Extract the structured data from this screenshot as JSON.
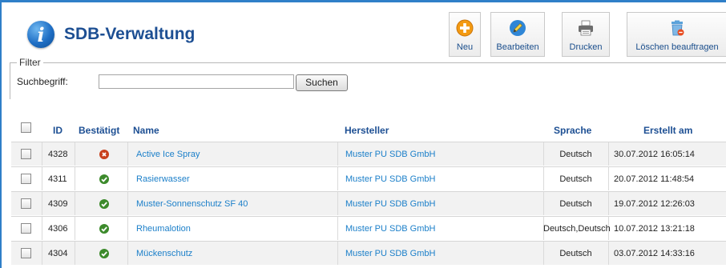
{
  "header": {
    "title": "SDB-Verwaltung",
    "logo_letter": "i"
  },
  "toolbar": {
    "new_label": "Neu",
    "edit_label": "Bearbeiten",
    "print_label": "Drucken",
    "delete_label": "Löschen beauftragen"
  },
  "filter": {
    "legend": "Filter",
    "search_label": "Suchbegriff:",
    "search_value": "",
    "search_button": "Suchen"
  },
  "table": {
    "columns": {
      "id": "ID",
      "confirmed": "Bestätigt",
      "name": "Name",
      "manufacturer": "Hersteller",
      "language": "Sprache",
      "created": "Erstellt am"
    },
    "rows": [
      {
        "id": "4328",
        "confirmed": false,
        "name": "Active Ice Spray",
        "manufacturer": "Muster PU SDB GmbH",
        "language": "Deutsch",
        "created": "30.07.2012 16:05:14"
      },
      {
        "id": "4311",
        "confirmed": true,
        "name": "Rasierwasser",
        "manufacturer": "Muster PU SDB GmbH",
        "language": "Deutsch",
        "created": "20.07.2012 11:48:54"
      },
      {
        "id": "4309",
        "confirmed": true,
        "name": "Muster-Sonnenschutz SF 40",
        "manufacturer": "Muster PU SDB GmbH",
        "language": "Deutsch",
        "created": "19.07.2012 12:26:03"
      },
      {
        "id": "4306",
        "confirmed": true,
        "name": "Rheumalotion",
        "manufacturer": "Muster PU SDB GmbH",
        "language": "Deutsch,Deutsch",
        "created": "10.07.2012 13:21:18"
      },
      {
        "id": "4304",
        "confirmed": true,
        "name": "Mückenschutz",
        "manufacturer": "Muster PU SDB GmbH",
        "language": "Deutsch",
        "created": "03.07.2012 14:33:16"
      }
    ]
  },
  "colors": {
    "accent": "#2f7fc8",
    "title": "#1d4f93",
    "link": "#1b7fc9",
    "ok": "#3c8a2b",
    "error": "#c8411d"
  }
}
